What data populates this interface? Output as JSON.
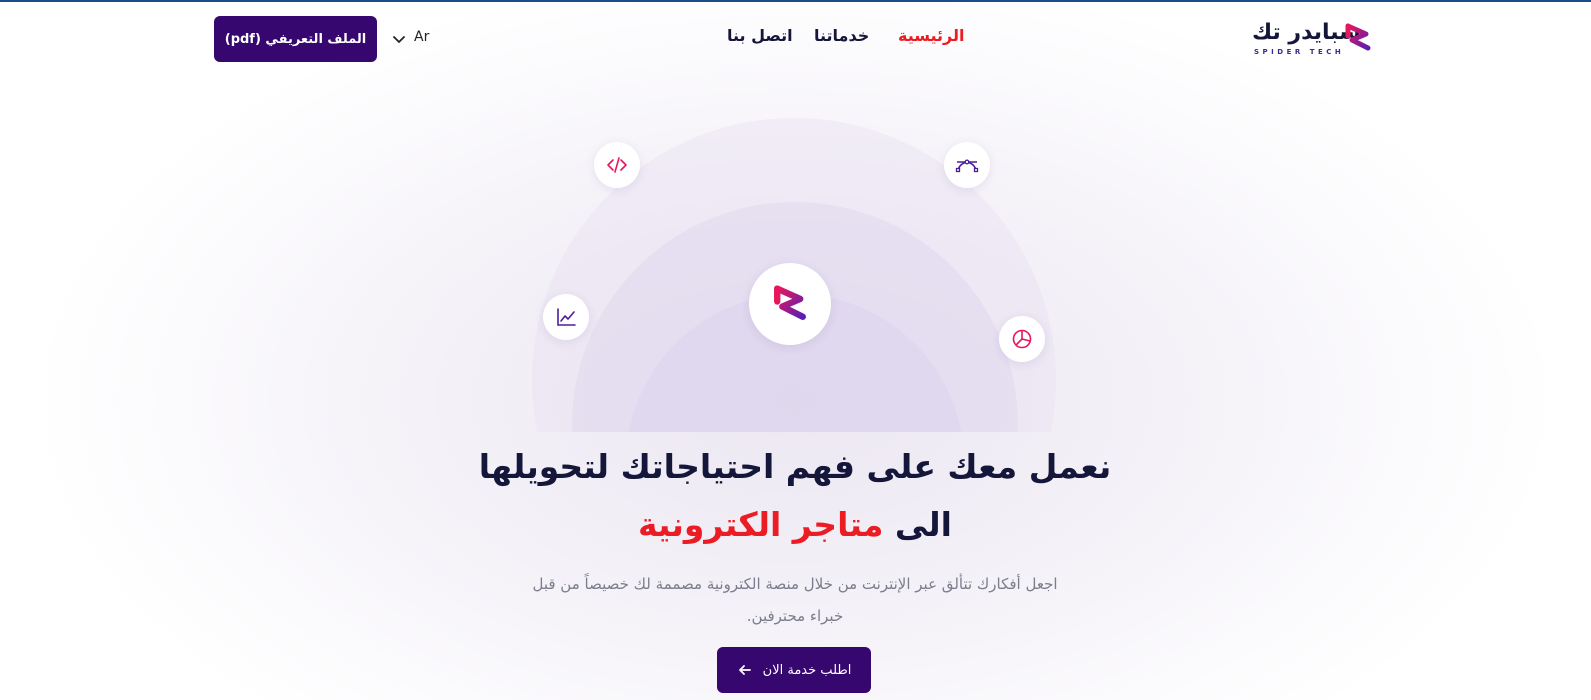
{
  "header": {
    "logo": {
      "text": "سبايدر تك",
      "subtext": "SPIDER TECH"
    },
    "nav": [
      {
        "label": "الرئيسية",
        "active": true
      },
      {
        "label": "خدماتنا",
        "active": false
      },
      {
        "label": "اتصل بنا",
        "active": false
      }
    ],
    "language": {
      "selected": "Ar",
      "icon": "chevron-down-icon"
    },
    "profile_button": {
      "label": "الملف التعريفي (pdf)"
    }
  },
  "hero": {
    "icons": [
      "logo-mark-icon",
      "code-icon",
      "bezier-curve-icon",
      "line-chart-icon",
      "pie-chart-icon"
    ],
    "headline_line1": "نعمل معك على فهم احتياجاتك لتحويلها",
    "headline_line2_prefix": "الى",
    "headline_line2_accent": "متاجر الكترونية",
    "description": "اجعل أفكارك تتألق عبر الإنترنت من خلال منصة الكترونية مصممة لك خصيصاً من قبل خبراء محترفين.",
    "cta": {
      "label": "اطلب خدمة الان",
      "icon": "arrow-left-icon"
    }
  },
  "colors": {
    "primary": "#36076e",
    "accent": "#ec1c24",
    "text_dark": "#14163a",
    "text_muted": "#7a7d8c",
    "icon_purple": "#4b1d9e",
    "icon_pink": "#e8175d"
  }
}
